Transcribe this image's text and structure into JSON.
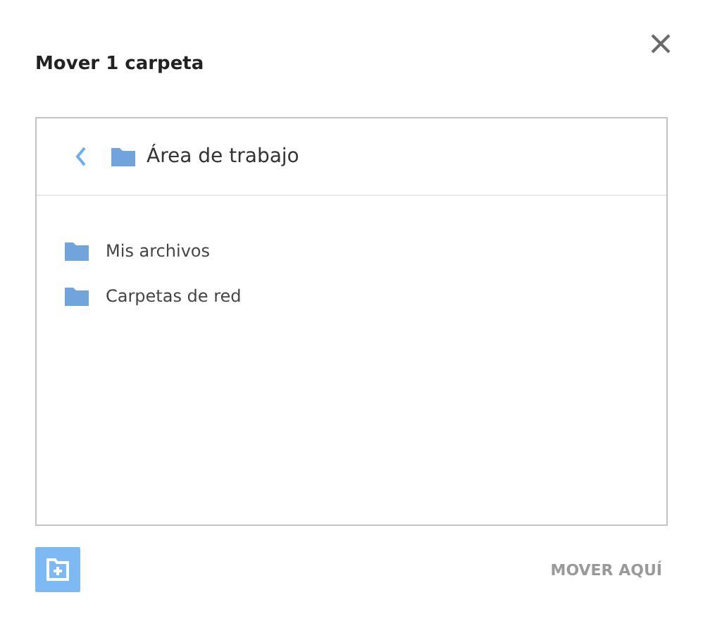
{
  "dialog": {
    "title": "Mover 1 carpeta"
  },
  "browser": {
    "current_folder": "Área de trabajo",
    "items": [
      {
        "label": "Mis archivos"
      },
      {
        "label": "Carpetas de red"
      }
    ]
  },
  "footer": {
    "move_button": {
      "label": "MOVER AQUÍ",
      "disabled": true
    }
  }
}
